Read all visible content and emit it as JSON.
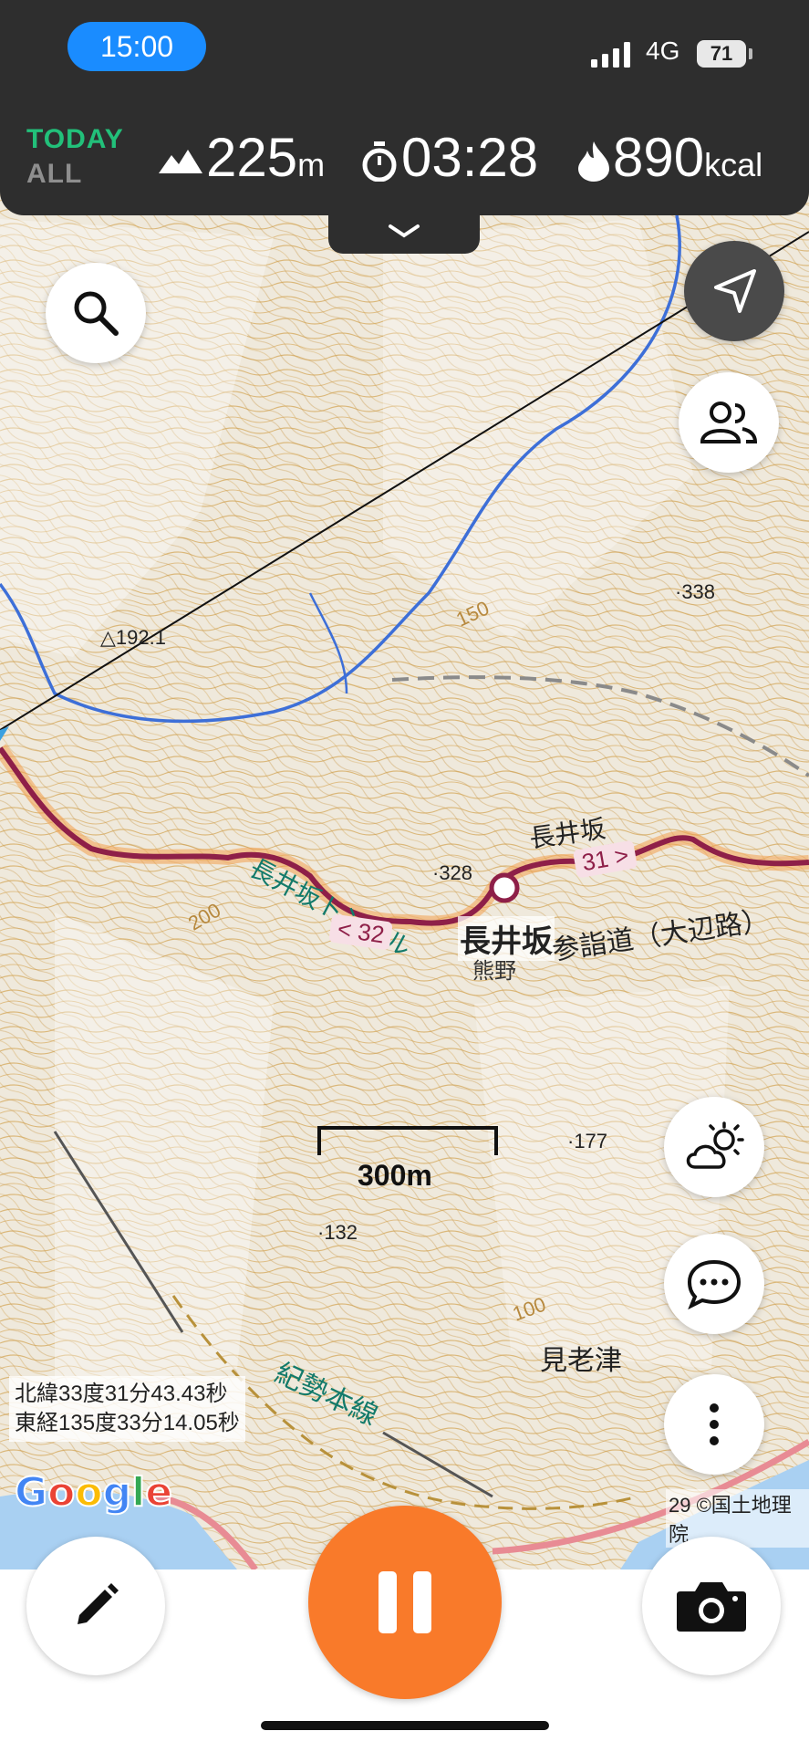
{
  "status_bar": {
    "time": "15:00",
    "network": "4G",
    "battery": "71"
  },
  "stats": {
    "filter_today": "TODAY",
    "filter_all": "ALL",
    "ascent_value": "225",
    "ascent_unit": "m",
    "duration": "03:28",
    "calories_value": "890",
    "calories_unit": "kcal"
  },
  "map": {
    "labels": {
      "peak_192": "△192.1",
      "spot_338": "·338",
      "spot_328": "·328",
      "spot_177": "·177",
      "spot_132": "·132",
      "contour_150": "150",
      "contour_200": "200",
      "contour_100": "100",
      "nagaizaka_small": "長井坂",
      "nagaizaka_bold": "長井坂",
      "tunnel": "長井坂トンネル",
      "sankeido": "参詣道（大辺路）",
      "kumano": "熊野",
      "miroudzu": "見老津",
      "kisei_line": "紀勢本線",
      "road_32": "< 32",
      "road_31": "31 >"
    },
    "scale_label": "300m",
    "coords": {
      "lat": "北緯33度31分43.43秒",
      "lon": "東経135度33分14.05秒"
    },
    "google_logo": "Google",
    "attribution": "29 ©国土地理院"
  },
  "buttons": {
    "search": "search",
    "locate": "navigation",
    "people": "people",
    "weather": "weather",
    "chat": "chat",
    "more": "more",
    "edit": "edit",
    "pause": "pause",
    "camera": "camera"
  },
  "colors": {
    "accent_green": "#22c07a",
    "pause_orange": "#f97a2a",
    "route_red": "#8e1f48",
    "river_blue": "#3d6fd8"
  }
}
